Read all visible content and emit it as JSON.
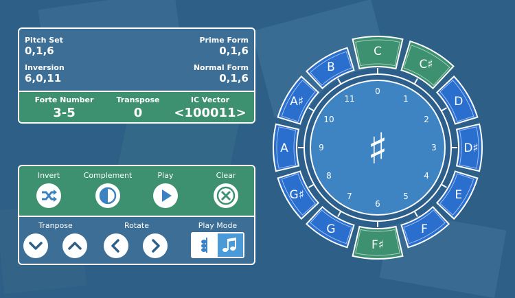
{
  "info": {
    "pitch_set_label": "Pitch Set",
    "pitch_set_value": "0,1,6",
    "prime_form_label": "Prime Form",
    "prime_form_value": "0,1,6",
    "inversion_label": "Inversion",
    "inversion_value": "6,0,11",
    "normal_form_label": "Normal Form",
    "normal_form_value": "0,1,6",
    "forte_label": "Forte Number",
    "forte_value": "3-5",
    "transpose_label": "Transpose",
    "transpose_value": "0",
    "ic_label": "IC Vector",
    "ic_value": "<100011>"
  },
  "controls": {
    "invert_label": "Invert",
    "complement_label": "Complement",
    "play_label": "Play",
    "clear_label": "Clear",
    "transpose_label": "Tranpose",
    "rotate_label": "Rotate",
    "play_mode_label": "Play Mode"
  },
  "wheel": {
    "center_symbol": "♯",
    "notes": [
      "C",
      "C♯",
      "D",
      "D♯",
      "E",
      "F",
      "F♯",
      "G",
      "G♯",
      "A",
      "A♯",
      "B"
    ],
    "selected": [
      true,
      true,
      false,
      false,
      false,
      false,
      true,
      false,
      false,
      false,
      false,
      false
    ],
    "numbers": [
      "0",
      "1",
      "2",
      "3",
      "4",
      "5",
      "6",
      "7",
      "8",
      "9",
      "10",
      "11"
    ]
  },
  "colors": {
    "background": "#2e5f86",
    "panel_blue": "#3d6f96",
    "panel_green": "#3d9171",
    "segment_blue": "#2a6fce",
    "segment_green": "#3d9171",
    "dial_blue": "#3e84c2"
  }
}
